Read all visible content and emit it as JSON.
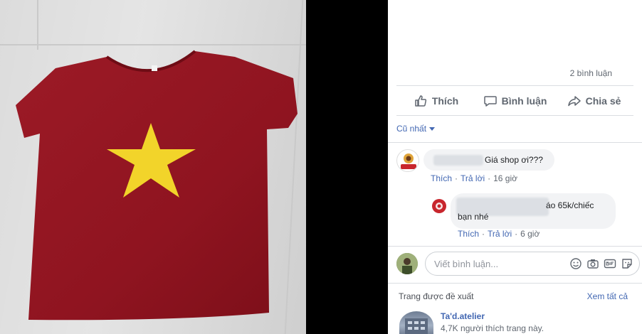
{
  "post": {
    "comment_count": "2 bình luận",
    "actions": {
      "like": "Thích",
      "comment": "Bình luận",
      "share": "Chia sẻ"
    },
    "sort_label": "Cũ nhất"
  },
  "comments": [
    {
      "text": "Giá shop ơi???",
      "like": "Thích",
      "reply": "Trả lời",
      "time": "16 giờ"
    },
    {
      "text_line1": "áo 65k/chiếc",
      "text_line2": "bạn nhé",
      "like": "Thích",
      "reply": "Trả lời",
      "time": "6 giờ"
    }
  ],
  "composer": {
    "placeholder": "Viết bình luận..."
  },
  "suggested": {
    "title": "Trang được đề xuất",
    "see_all": "Xem tất cả",
    "page_name": "Ta'd.atelier",
    "page_likes": "4,7K người thích trang này."
  },
  "colors": {
    "shirt": "#8f1420",
    "star": "#f2d42a",
    "link": "#4267b2"
  },
  "icons": [
    "like-icon",
    "comment-icon",
    "share-icon",
    "emoji-icon",
    "camera-icon",
    "gif-icon",
    "sticker-icon"
  ]
}
